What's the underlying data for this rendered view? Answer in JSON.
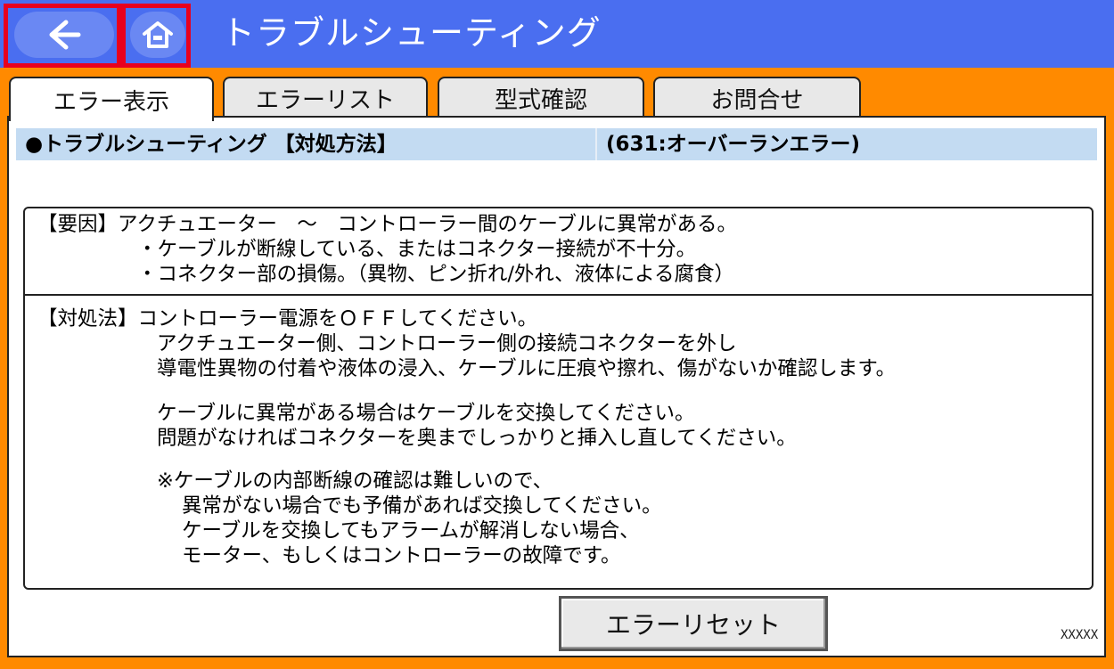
{
  "header": {
    "title": "トラブルシューティング",
    "back_icon": "arrow-left-icon",
    "home_icon": "home-icon",
    "bg_color": "#4a6ef0",
    "highlight_color": "#e8001e"
  },
  "tabs": [
    {
      "label": "エラー表示",
      "active": true
    },
    {
      "label": "エラーリスト",
      "active": false
    },
    {
      "label": "型式確認",
      "active": false
    },
    {
      "label": "お問合せ",
      "active": false
    }
  ],
  "status": {
    "left": "●トラブルシューティング 【対処方法】",
    "right": "(631:オーバーランエラー)"
  },
  "cause": {
    "lines": [
      "【要因】アクチュエーター　～　コントローラー間のケーブルに異常がある。",
      "・ケーブルが断線している、またはコネクター接続が不十分。",
      "・コネクター部の損傷。（異物、ピン折れ/外れ、液体による腐食）"
    ]
  },
  "remedy": {
    "lines": [
      "【対処法】コントローラー電源をＯＦＦしてください。",
      "アクチュエーター側、コントローラー側の接続コネクターを外し",
      "導電性異物の付着や液体の浸入、ケーブルに圧痕や擦れ、傷がないか確認します。",
      "ケーブルに異常がある場合はケーブルを交換してください。",
      "問題がなければコネクターを奥までしっかりと挿入し直してください。",
      "※ケーブルの内部断線の確認は難しいので、",
      "異常がない場合でも予備があれば交換してください。",
      "ケーブルを交換してもアラームが解消しない場合、",
      "モーター、もしくはコントローラーの故障です。"
    ]
  },
  "reset_button": "エラーリセット",
  "code_label": "XXXXX",
  "colors": {
    "frame": "#ff8a00",
    "status_bar": "#c3dbf2"
  }
}
